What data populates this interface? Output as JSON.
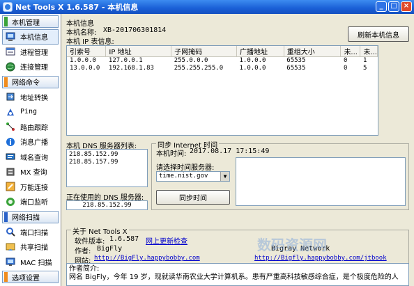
{
  "window": {
    "title": "Net Tools X 1.6.587 - 本机信息",
    "min": "_",
    "max": "□",
    "close": "×"
  },
  "sidebar": {
    "sections": [
      {
        "label": "本机管理",
        "color": "#3aa33a",
        "items": [
          {
            "label": "本机信息",
            "icon": "computer-icon"
          },
          {
            "label": "进程管理",
            "icon": "process-icon"
          },
          {
            "label": "连接管理",
            "icon": "globe-icon"
          }
        ]
      },
      {
        "label": "网络命令",
        "color": "#f08c1e",
        "items": [
          {
            "label": "地址转换",
            "icon": "convert-icon"
          },
          {
            "label": "Ping",
            "icon": "ping-icon"
          },
          {
            "label": "路由跟踪",
            "icon": "route-icon"
          },
          {
            "label": "消息广播",
            "icon": "info-icon"
          },
          {
            "label": "域名查询",
            "icon": "domain-icon"
          },
          {
            "label": "MX 查询",
            "icon": "mx-icon"
          },
          {
            "label": "万能连接",
            "icon": "connect-icon"
          },
          {
            "label": "端口监听",
            "icon": "listen-icon"
          }
        ]
      },
      {
        "label": "网络扫描",
        "color": "#2a62c9",
        "items": [
          {
            "label": "端口扫描",
            "icon": "port-scan-icon"
          },
          {
            "label": "共享扫描",
            "icon": "share-icon"
          },
          {
            "label": "MAC 扫描",
            "icon": "mac-icon"
          }
        ]
      },
      {
        "label": "选项设置",
        "color": "#f08c1e",
        "items": []
      }
    ]
  },
  "info": {
    "heading": "本机信息",
    "name_label": "本机名称:",
    "name_value": "XB-201706301814",
    "ip_table_label": "本机 IP 表信息:",
    "refresh_button": "刷新本机信息",
    "columns": [
      "引索号",
      "IP 地址",
      "子网掩码",
      "广播地址",
      "重组大小",
      "未...",
      "未..."
    ],
    "rows": [
      [
        "1.0.0.0",
        "127.0.0.1",
        "255.0.0.0",
        "1.0.0.0",
        "65535",
        "0",
        "1"
      ],
      [
        "13.0.0.0",
        "192.168.1.83",
        "255.255.255.0",
        "1.0.0.0",
        "65535",
        "0",
        "5"
      ]
    ]
  },
  "dns": {
    "list_label": "本机 DNS 服务器列表:",
    "servers": [
      "218.85.152.99",
      "218.85.157.99"
    ],
    "current_label": "正在使用的 DNS 服务器:",
    "current": "218.85.152.99"
  },
  "time_sync": {
    "title": "同步 Internet 时间",
    "local_time_label": "本机时间:",
    "local_time": "2017.08.17 17:15:49",
    "server_label": "请选择时间服务器:",
    "server": "time.nist.gov",
    "sync_button": "同步时间"
  },
  "about": {
    "title": "关于 Net Tools X",
    "version_label": "软件版本:",
    "version": "1.6.587",
    "update_link": "网上更新检查",
    "author_label": "作者:",
    "author": "BigFly",
    "site_label": "网站:",
    "site_url": "http://BigFly.happybobby.com",
    "publisher": "Bigray Network",
    "publisher_link": "http://Bigfly.happybobby.com/jtbook",
    "intro_label": "作者简介:",
    "intro_text": "网名 BigFly，今年 19 岁，现就读华南农业大学计算机系。患有严重高科技敏感综合症，是个极度危险的人",
    "watermark": "数码资源网"
  }
}
